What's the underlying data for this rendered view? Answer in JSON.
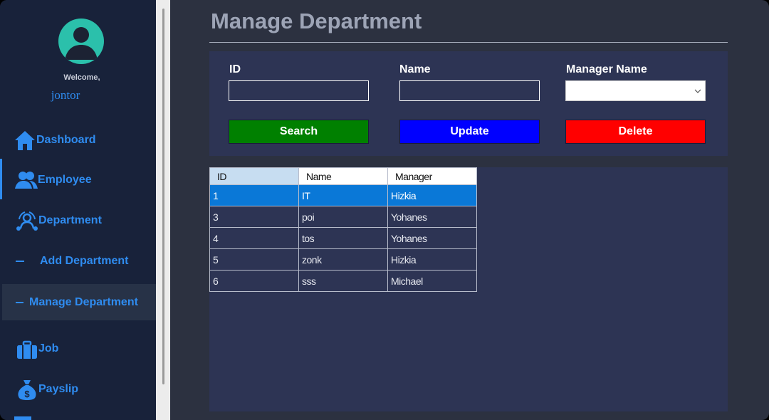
{
  "sidebar": {
    "welcome": "Welcome,",
    "username": "jontor",
    "items": [
      {
        "label": "Dashboard",
        "icon": "home-icon"
      },
      {
        "label": "Employee",
        "icon": "users-icon"
      },
      {
        "label": "Department",
        "icon": "department-icon"
      },
      {
        "label": "Add Department",
        "icon": "dash-icon"
      },
      {
        "label": "Manage Department",
        "icon": "dash-icon"
      },
      {
        "label": "Job",
        "icon": "briefcase-icon"
      },
      {
        "label": "Payslip",
        "icon": "money-bag-icon"
      }
    ],
    "accent_color": "#2f8cf0"
  },
  "page": {
    "title": "Manage Department"
  },
  "form": {
    "id_label": "ID",
    "id_value": "",
    "name_label": "Name",
    "name_value": "",
    "manager_label": "Manager Name",
    "manager_value": "",
    "search_button": "Search",
    "update_button": "Update",
    "delete_button": "Delete",
    "colors": {
      "search": "#008000",
      "update": "#0000ff",
      "delete": "#ff0000"
    }
  },
  "grid": {
    "columns": [
      "ID",
      "Name",
      "Manager"
    ],
    "rows": [
      [
        "1",
        "IT",
        "Hizkia"
      ],
      [
        "3",
        "poi",
        "Yohanes"
      ],
      [
        "4",
        "tos",
        "Yohanes"
      ],
      [
        "5",
        "zonk",
        "Hizkia"
      ],
      [
        "6",
        "sss",
        "Michael"
      ]
    ],
    "selected_row": 0
  }
}
